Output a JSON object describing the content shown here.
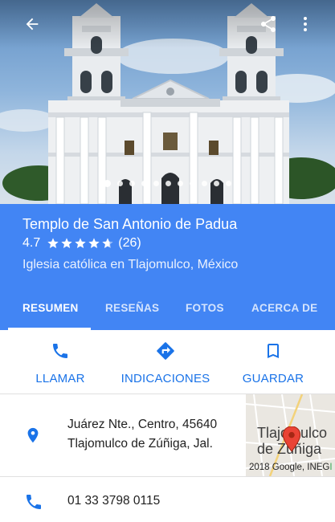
{
  "place": {
    "name": "Templo de San Antonio de Padua",
    "rating": "4.7",
    "rating_value": 4.7,
    "review_count": "(26)",
    "category": "Iglesia católica en Tlajomulco, México"
  },
  "photo": {
    "total_photos": 11,
    "current_index": 1
  },
  "tabs": [
    {
      "label": "RESUMEN",
      "active": true
    },
    {
      "label": "RESEÑAS",
      "active": false
    },
    {
      "label": "FOTOS",
      "active": false
    },
    {
      "label": "ACERCA DE",
      "active": false
    }
  ],
  "actions": {
    "call": {
      "label": "LLAMAR",
      "icon": "phone-icon"
    },
    "directions": {
      "label": "INDICACIONES",
      "icon": "directions-icon"
    },
    "save": {
      "label": "GUARDAR",
      "icon": "bookmark-icon"
    }
  },
  "address": {
    "line1": "Juárez Nte., Centro, 45640",
    "line2": "Tlajomulco de Zúñiga, Jal."
  },
  "map": {
    "city_line1": "Tlajomulco",
    "city_line2": "de Zúñiga",
    "copyright_prefix": "2018 Google, INEG",
    "copyright_suffix": "I"
  },
  "phone": {
    "number": "01 33 3798 0115"
  },
  "colors": {
    "accent": "#4285f4",
    "action_text": "#1a73e8",
    "pin": "#ea4335"
  }
}
